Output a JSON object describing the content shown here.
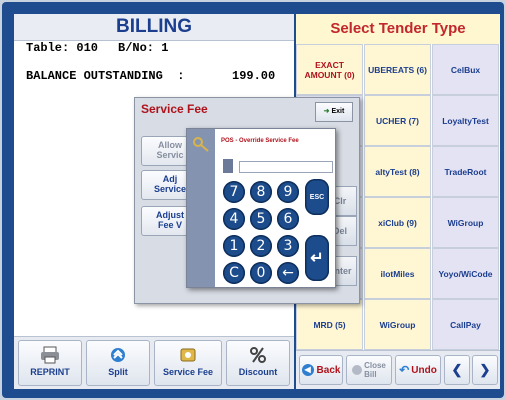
{
  "billing": {
    "title": "BILLING",
    "table_label": "Table: 010",
    "bill_label": "B/No: 1",
    "balance_label": "BALANCE OUTSTANDING  :",
    "balance_value": "199.00"
  },
  "bottom_buttons": [
    {
      "label": "REPRINT",
      "icon": "printer-icon"
    },
    {
      "label": "Split",
      "icon": "split-icon"
    },
    {
      "label": "Service Fee",
      "icon": "service-fee-icon"
    },
    {
      "label": "Discount",
      "icon": "percent-icon"
    }
  ],
  "tender": {
    "title": "Select Tender Type",
    "cells": [
      {
        "label": "EXACT\nAMOUNT (0)",
        "style": "cream-red"
      },
      {
        "label": "UBEREATS (6)",
        "style": "cream"
      },
      {
        "label": "CelBux",
        "style": "lav"
      },
      {
        "label": "UCHER (7)",
        "style": "cream"
      },
      {
        "label": "LoyaltyTest",
        "style": "lav"
      },
      {
        "label": "altyTest (8)",
        "style": "cream"
      },
      {
        "label": "TradeRoot",
        "style": "lav"
      },
      {
        "label": "xiClub (9)",
        "style": "cream"
      },
      {
        "label": "WiGroup",
        "style": "lav"
      },
      {
        "label": "ilotMiles",
        "style": "cream"
      },
      {
        "label": "Yoyo/WiCode",
        "style": "lav"
      },
      {
        "label": "MRD (5)",
        "style": "cream"
      },
      {
        "label": "WiGroup",
        "style": "cream"
      },
      {
        "label": "CallPay",
        "style": "lav"
      }
    ],
    "bar": {
      "back": "Back",
      "close_bill": "Close\nBill",
      "undo": "Undo",
      "prev": "❮",
      "next": "❯"
    }
  },
  "service_fee": {
    "title": "Service Fee",
    "exit": "Exit",
    "side_buttons": [
      "Allow\nServic",
      "Adj\nService",
      "Adjust\nFee V"
    ],
    "bg_keys": [
      "Clr",
      "Del",
      "Enter"
    ]
  },
  "keypad": {
    "title": "POS - Override Service Fee",
    "keys": [
      "7",
      "8",
      "9",
      "4",
      "5",
      "6",
      "1",
      "2",
      "3",
      "C",
      "0",
      "←"
    ],
    "esc": "ESC",
    "enter": "↵"
  },
  "colors": {
    "frame": "#1f4c8f",
    "accent_red": "#b0121c",
    "accent_blue": "#1b3e8f",
    "key_blue": "#1d4c8c"
  }
}
